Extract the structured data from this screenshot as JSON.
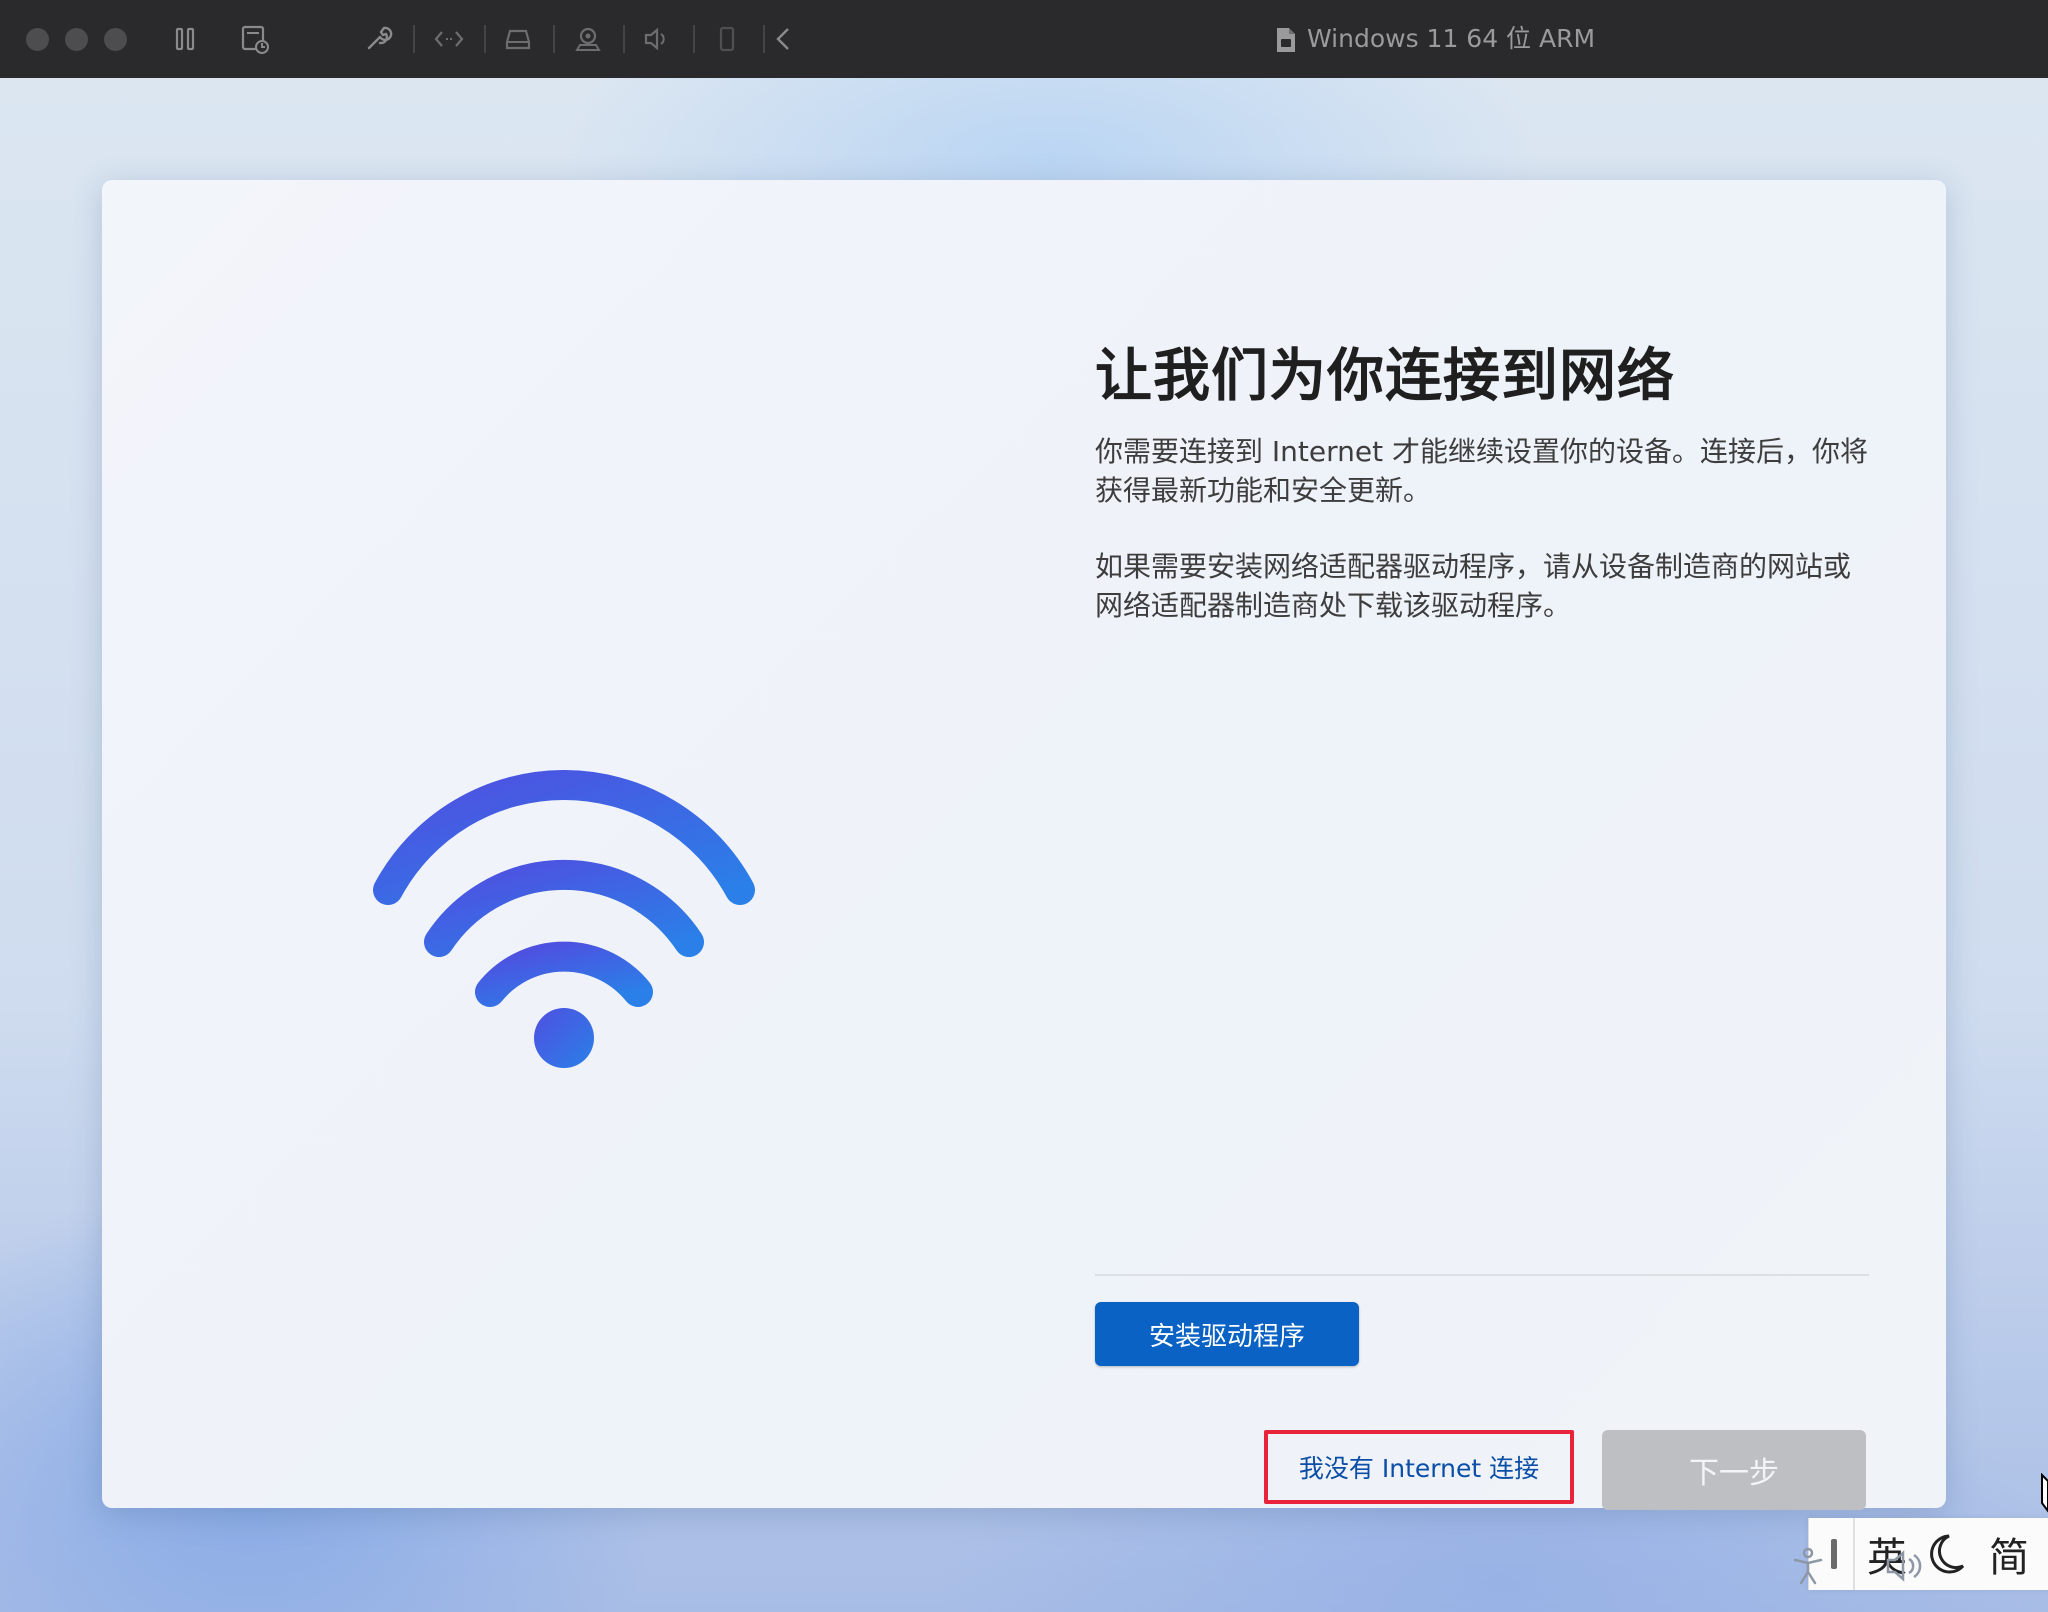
{
  "window": {
    "title": "Windows 11 64 位 ARM"
  },
  "toolbar": {
    "icons": [
      "pause-icon",
      "snapshot-icon",
      "settings-wrench-icon",
      "code-icon",
      "disk-icon",
      "camera-icon",
      "sound-icon",
      "usb-icon",
      "back-icon"
    ]
  },
  "oobe": {
    "title": "让我们为你连接到网络",
    "paragraph1": "你需要连接到 Internet 才能继续设置你的设备。连接后，你将获得最新功能和安全更新。",
    "paragraph2": "如果需要安装网络适配器驱动程序，请从设备制造商的网站或网络适配器制造商处下载该驱动程序。",
    "install_driver_label": "安装驱动程序",
    "no_internet_label": "我没有 Internet 连接",
    "next_label": "下一步"
  },
  "ime": {
    "mode": "英",
    "script": "简"
  },
  "colors": {
    "primary_button": "#0a62c4",
    "highlight_box": "#e8233a",
    "disabled_button": "#bdbfc3",
    "wifi_start": "#4a53e0",
    "wifi_end": "#2f7fe6"
  }
}
